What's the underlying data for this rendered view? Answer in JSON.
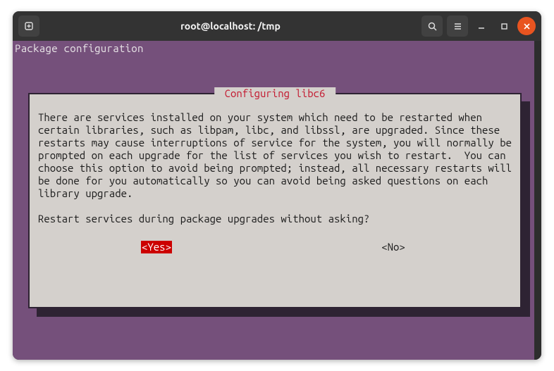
{
  "titlebar": {
    "title": "root@localhost: /tmp"
  },
  "terminal": {
    "header": "Package configuration"
  },
  "dialog": {
    "title": " Configuring libc6 ",
    "body": "There are services installed on your system which need to be restarted when certain libraries, such as libpam, libc, and libssl, are upgraded. Since these restarts may cause interruptions of service for the system, you will normally be prompted on each upgrade for the list of services you wish to restart.  You can choose this option to avoid being prompted; instead, all necessary restarts will be done for you automatically so you can avoid being asked questions on each library upgrade.",
    "question": "Restart services during package upgrades without asking?",
    "yes": "<Yes>",
    "no": "<No>"
  }
}
